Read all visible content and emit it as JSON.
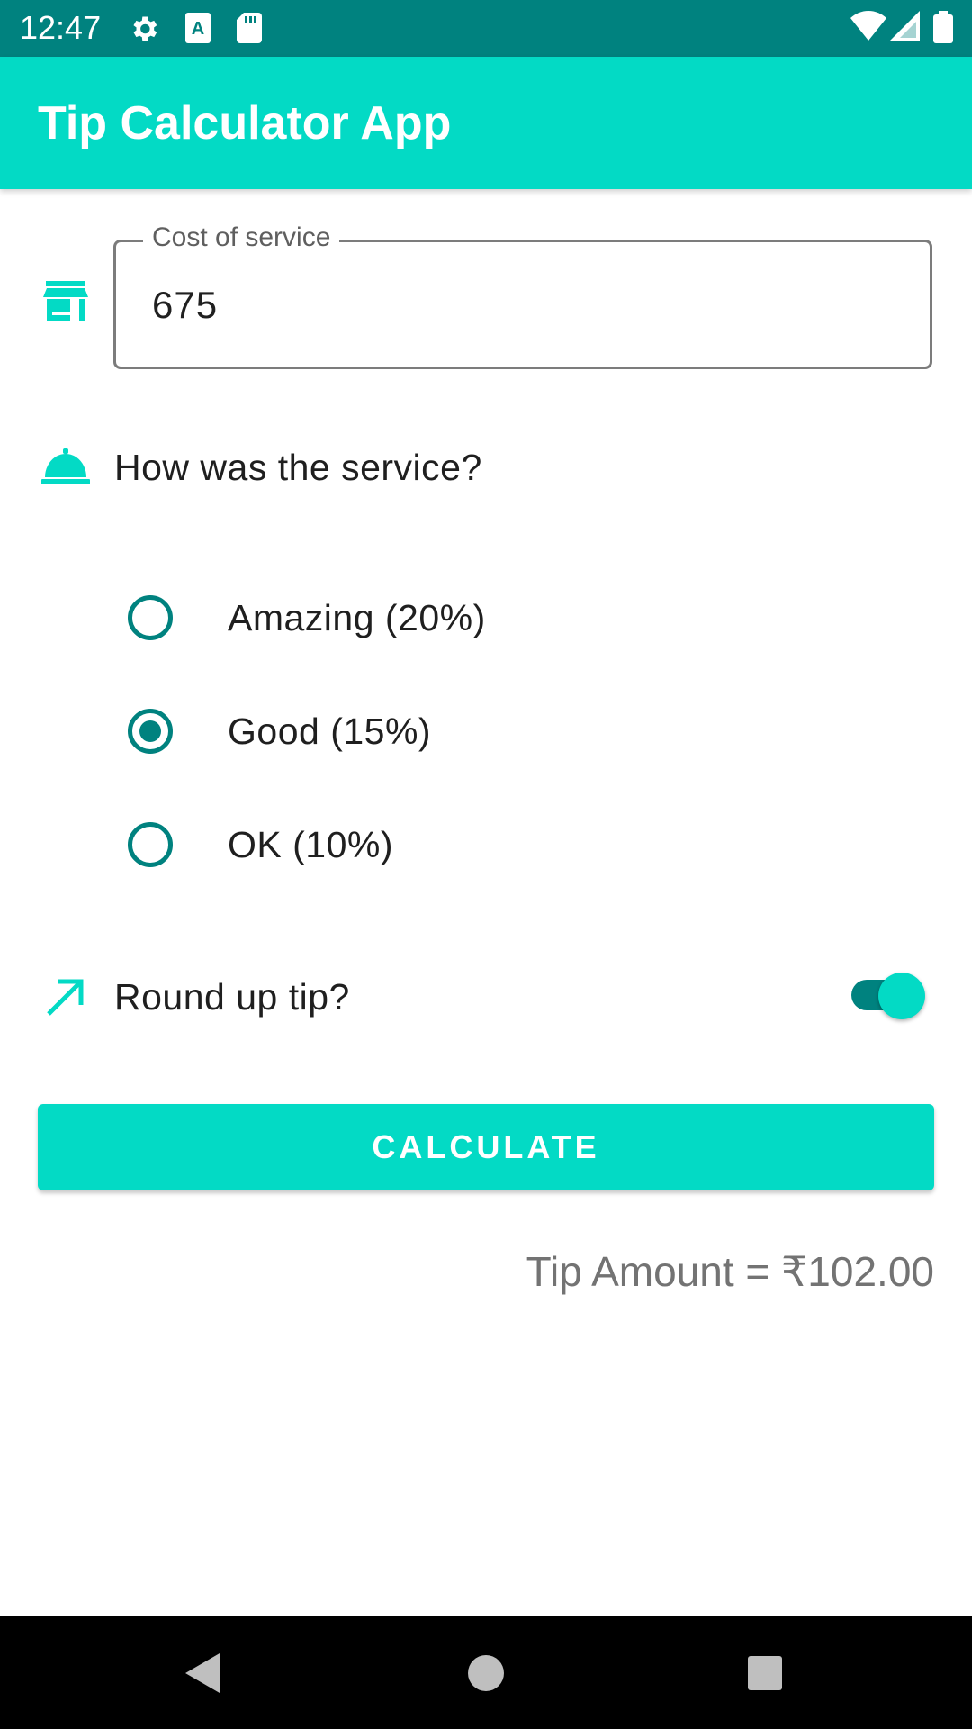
{
  "status_bar": {
    "time": "12:47",
    "left_icons": [
      "gear-icon",
      "text-a-icon",
      "sd-card-icon"
    ],
    "right_icons": [
      "wifi-icon",
      "cell-signal-icon",
      "battery-icon"
    ],
    "background": "#00827f"
  },
  "app_bar": {
    "title": "Tip Calculator App",
    "background": "#03dac5"
  },
  "cost_field": {
    "icon": "store-icon",
    "label": "Cost of service",
    "value": "675"
  },
  "service_question": {
    "icon": "room-service-icon",
    "text": "How was the service?"
  },
  "tip_options": [
    {
      "label": "Amazing (20%)",
      "selected": false
    },
    {
      "label": "Good (15%)",
      "selected": true
    },
    {
      "label": "OK (10%)",
      "selected": false
    }
  ],
  "round_up": {
    "icon": "trending-up-icon",
    "label": "Round up tip?",
    "enabled": true
  },
  "calculate_button": {
    "label": "CALCULATE"
  },
  "result": {
    "text": "Tip Amount = ₹102.00"
  },
  "nav_bar": {
    "buttons": [
      "back-icon",
      "home-icon",
      "recents-icon"
    ]
  },
  "colors": {
    "primary": "#03dac5",
    "primary_dark": "#00827f",
    "text": "#1f1f1f",
    "result_text": "#737373"
  }
}
